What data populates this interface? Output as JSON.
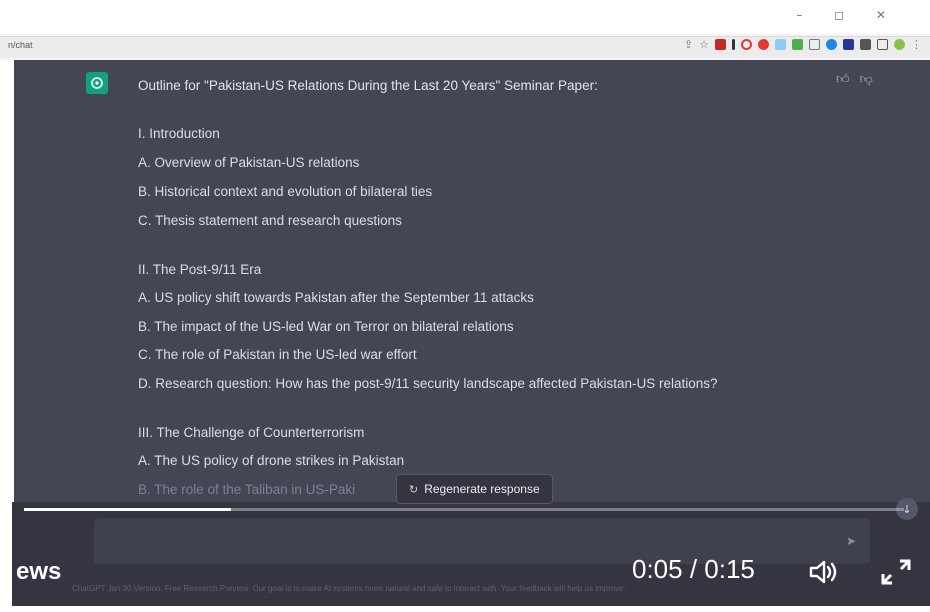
{
  "browser": {
    "url_fragment": "n/chat",
    "window_controls": "– ◻ ✕"
  },
  "message": {
    "title": "Outline for \"Pakistan-US Relations During the Last 20 Years\" Seminar Paper:",
    "lines": [
      "I. Introduction",
      "A. Overview of Pakistan-US relations",
      "B. Historical context and evolution of bilateral ties",
      "C. Thesis statement and research questions",
      "II. The Post-9/11 Era",
      "A. US policy shift towards Pakistan after the September 11 attacks",
      "B. The impact of the US-led War on Terror on bilateral relations",
      "C. The role of Pakistan in the US-led war effort",
      "D. Research question: How has the post-9/11 security landscape affected Pakistan-US relations?",
      "III. The Challenge of Counterterrorism",
      "A. The US policy of drone strikes in Pakistan",
      "B. The role of the Taliban in US-Paki"
    ]
  },
  "regenerate": {
    "label": "Regenerate response"
  },
  "footer": {
    "note": "ChatGPT Jan 30 Version. Free Research Preview. Our goal is to make AI systems more natural and safe to interact with. Your feedback will help us improve."
  },
  "video": {
    "channel_label": "ews",
    "time": "0:05 / 0:15",
    "progress_fraction": 0.235
  },
  "colors": {
    "chat_bg": "#444654",
    "accent": "#10a37f"
  }
}
